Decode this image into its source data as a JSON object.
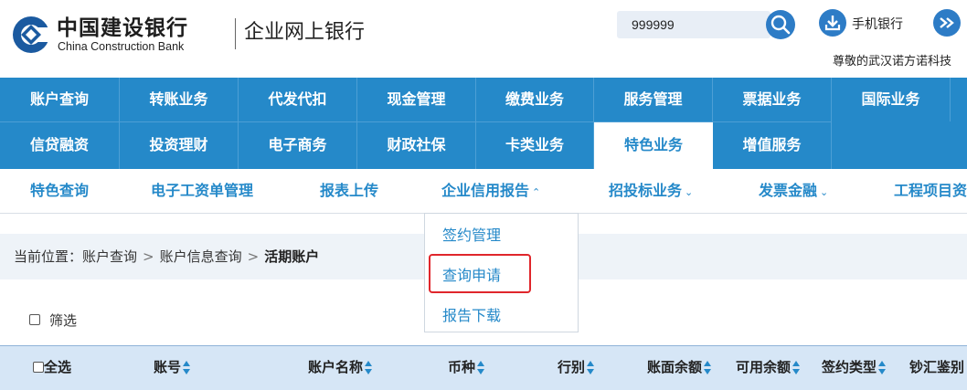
{
  "header": {
    "bank_name_cn": "中国建设银行",
    "bank_name_en": "China Construction Bank",
    "system_title": "企业网上银行",
    "search_value": "999999",
    "mobile_bank_label": "手机银行",
    "welcome_text": "尊敬的武汉诺方诺科技"
  },
  "main_nav": {
    "row1": [
      "账户查询",
      "转账业务",
      "代发代扣",
      "现金管理",
      "缴费业务",
      "服务管理",
      "票据业务",
      "国际业务"
    ],
    "row2": [
      "信贷融资",
      "投资理财",
      "电子商务",
      "财政社保",
      "卡类业务",
      "特色业务",
      "增值服务"
    ],
    "active": "特色业务"
  },
  "sub_nav": {
    "items": [
      "特色查询",
      "电子工资单管理",
      "报表上传",
      "企业信用报告",
      "招投标业务",
      "发票金融",
      "工程项目资"
    ],
    "carets": [
      "",
      "",
      "",
      "⌃",
      "⌄",
      "⌄",
      ""
    ]
  },
  "dropdown": {
    "items": [
      "签约管理",
      "查询申请",
      "报告下载"
    ],
    "highlighted": "查询申请"
  },
  "breadcrumb": {
    "prefix": "当前位置：",
    "path": [
      "账户查询",
      "账户信息查询",
      "活期账户"
    ],
    "separator": ">"
  },
  "filter": {
    "label": "筛选",
    "checked": false
  },
  "table": {
    "select_all_label": "全选",
    "columns": [
      "账号",
      "账户名称",
      "币种",
      "行别",
      "账面余额",
      "可用余额",
      "签约类型",
      "钞汇鉴别"
    ]
  },
  "colors": {
    "brand_blue": "#2589c9",
    "highlight_red": "#e0262b",
    "breadcrumb_bg": "#eef3f8",
    "table_header_bg": "#d6e6f6"
  }
}
